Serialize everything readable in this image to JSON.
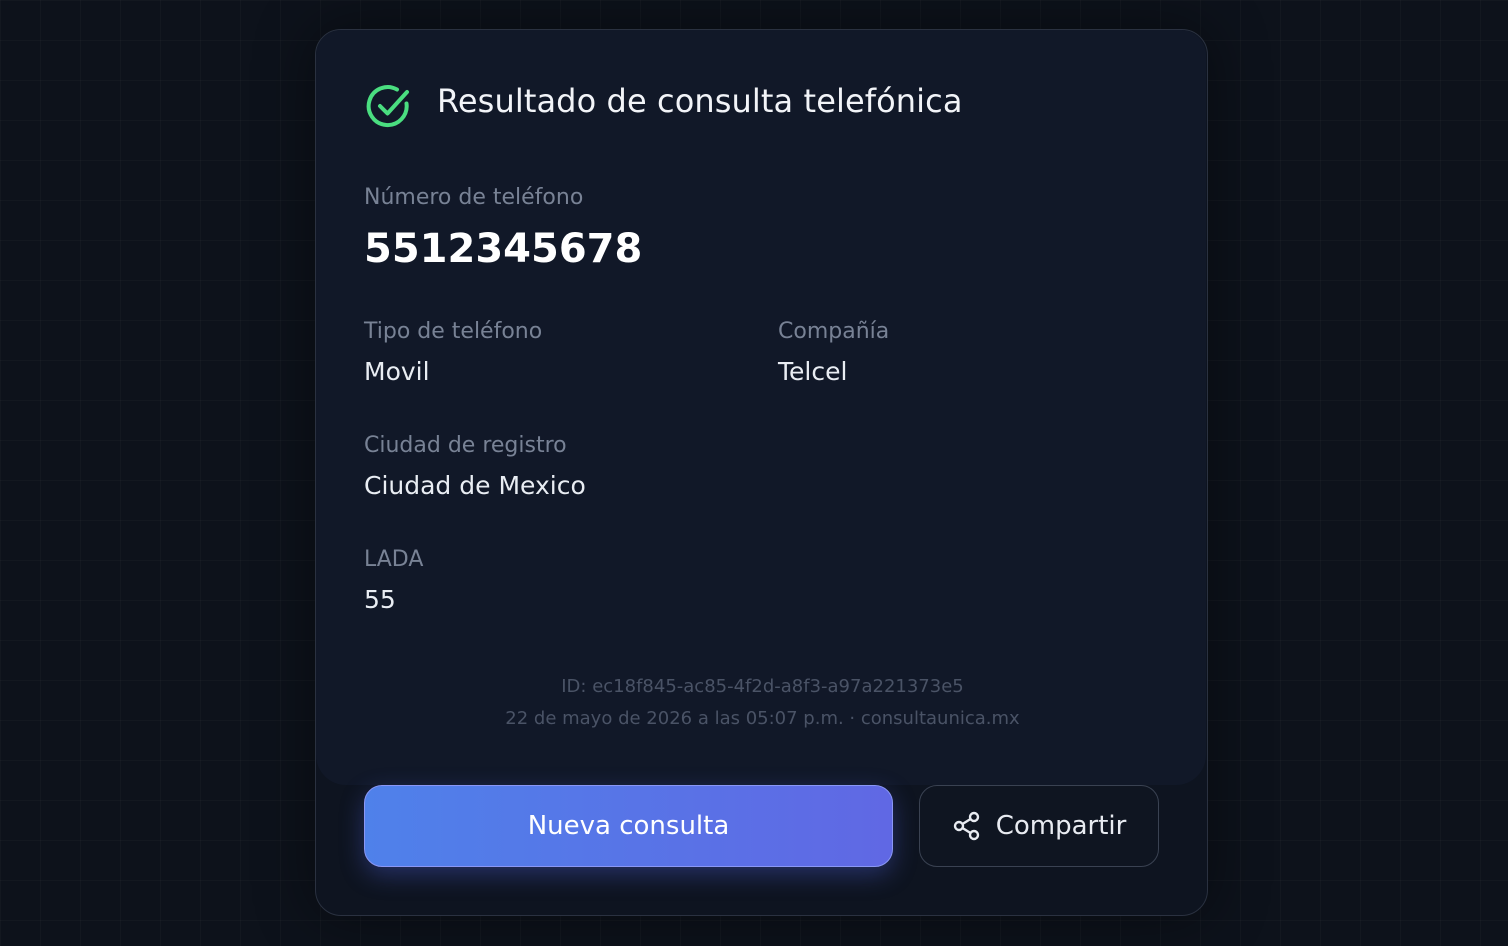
{
  "header": {
    "title": "Resultado de consulta telefónica"
  },
  "phone": {
    "label": "Número de teléfono",
    "value": "5512345678"
  },
  "fields": {
    "type_label": "Tipo de teléfono",
    "type_value": "Movil",
    "company_label": "Compañía",
    "company_value": "Telcel",
    "city_label": "Ciudad de registro",
    "city_value": "Ciudad de Mexico",
    "lada_label": "LADA",
    "lada_value": "55"
  },
  "footer": {
    "id_line": "ID: ec18f845-ac85-4f2d-a8f3-a97a221373e5",
    "date_line": "22 de mayo de 2026 a las 05:07 p.m. · consultaunica.mx"
  },
  "actions": {
    "new_query_label": "Nueva consulta",
    "share_label": "Compartir"
  },
  "icons": {
    "success": "check-circle-icon",
    "share": "share-icon"
  },
  "colors": {
    "success": "#4ade80",
    "primary_start": "#4f81ea",
    "primary_end": "#6068e4"
  }
}
